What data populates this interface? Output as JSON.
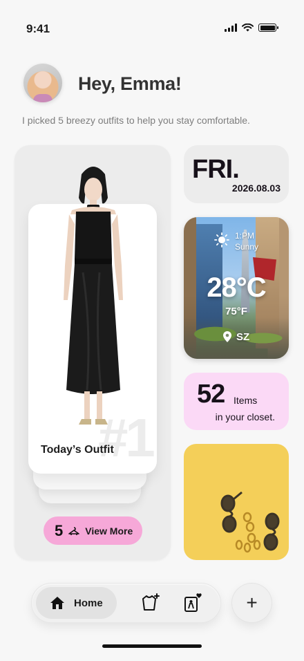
{
  "status_bar": {
    "time": "9:41"
  },
  "header": {
    "greeting": "Hey, Emma!",
    "subtitle": "I picked 5 breezy outfits to help you stay comfortable."
  },
  "outfit": {
    "number": "#1",
    "label": "Today’s Outfit",
    "view_more_count": "5",
    "view_more_label": "View More"
  },
  "date_card": {
    "day": "FRI.",
    "date": "2026.08.03"
  },
  "weather": {
    "time": "1:PM",
    "condition": "Sunny",
    "temp_c": "28°C",
    "temp_f": "75°F",
    "location": "SZ"
  },
  "closet": {
    "count": "52",
    "unit": "Items",
    "subtitle": "in your closet."
  },
  "nav": {
    "home_label": "Home",
    "add_label": "+"
  },
  "colors": {
    "background": "#f7f7f7",
    "view_more_pink": "#f6a8d8",
    "closet_pink": "#fbd9f6",
    "accessory_yellow": "#f4cf59"
  }
}
